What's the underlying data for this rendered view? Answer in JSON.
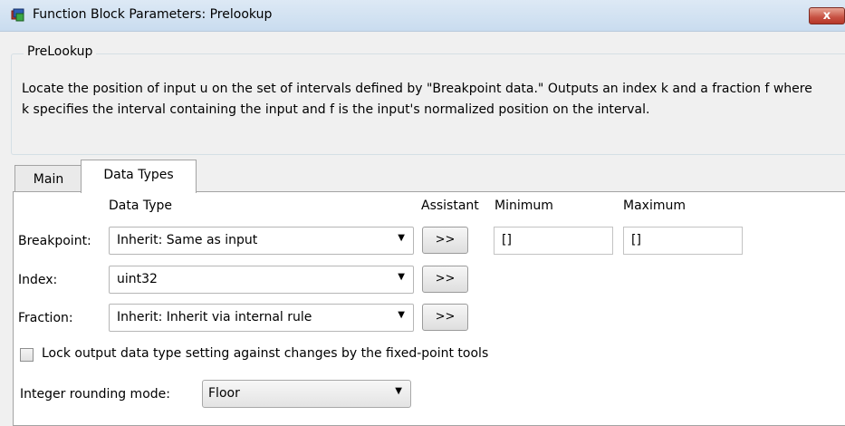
{
  "window": {
    "title": "Function Block Parameters: Prelookup",
    "close_label": "x"
  },
  "group": {
    "title": "PreLookup",
    "description": "Locate the position of input u on the set of intervals defined by \"Breakpoint data.\" Outputs an index k and a fraction f where k specifies the interval containing the input and f is the input's normalized position on the interval."
  },
  "tabs": [
    {
      "label": "Main",
      "selected": false
    },
    {
      "label": "Data Types",
      "selected": true
    }
  ],
  "columns": {
    "data_type": "Data Type",
    "assistant": "Assistant",
    "minimum": "Minimum",
    "maximum": "Maximum"
  },
  "rows": [
    {
      "label": "Breakpoint:",
      "data_type": "Inherit: Same as input",
      "assistant": ">>",
      "minimum": "[]",
      "maximum": "[]"
    },
    {
      "label": "Index:",
      "data_type": "uint32",
      "assistant": ">>"
    },
    {
      "label": "Fraction:",
      "data_type": "Inherit: Inherit via internal rule",
      "assistant": ">>"
    }
  ],
  "lock": {
    "label": "Lock output data type setting against changes by the fixed-point tools",
    "checked": false
  },
  "rounding": {
    "label": "Integer rounding mode:",
    "value": "Floor"
  },
  "icons": {
    "app": "simulink-block-icon",
    "dropdown": "chevron-down-icon",
    "close": "close-icon"
  }
}
